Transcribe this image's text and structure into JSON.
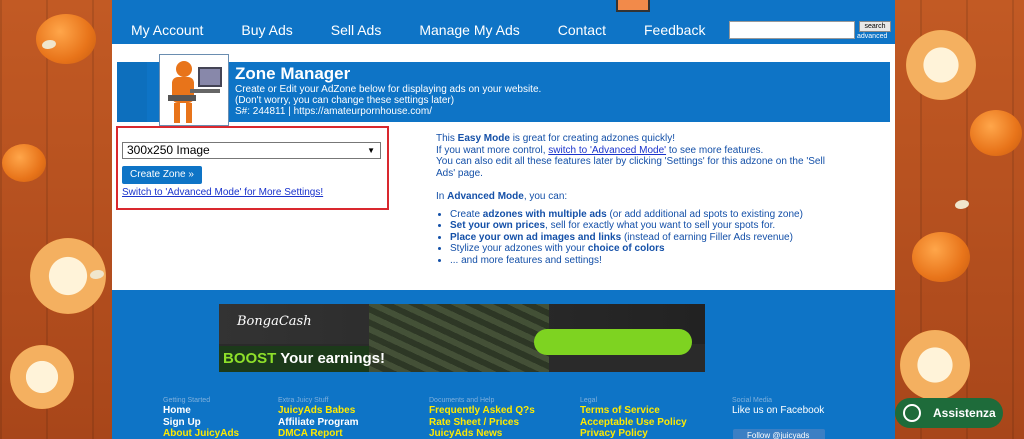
{
  "nav": {
    "items": [
      "My Account",
      "Buy Ads",
      "Sell Ads",
      "Manage My Ads",
      "Contact",
      "Feedback"
    ],
    "search_label": "search",
    "advanced_label": "advanced"
  },
  "zone_header": {
    "title": "Zone Manager",
    "line1": "Create or Edit your AdZone below for displaying ads on your website.",
    "line2": "(Don't worry, you can change these settings later)",
    "line3": "S#: 244811 | https://amateurpornhouse.com/"
  },
  "zone_form": {
    "select_value": "300x250 Image",
    "create_button": "Create Zone »",
    "advanced_link": "Switch to 'Advanced Mode' for More Settings!"
  },
  "info": {
    "p1_a": "This ",
    "p1_b": "Easy Mode",
    "p1_c": " is great for creating adzones quickly!",
    "p2_a": "If you want more control, ",
    "p2_link": "switch to 'Advanced Mode'",
    "p2_c": " to see more features.",
    "p3": "You can also edit all these features later by clicking 'Settings' for this adzone on the 'Sell Ads' page.",
    "p4_a": "In ",
    "p4_b": "Advanced Mode",
    "p4_c": ", you can:",
    "bullets": [
      {
        "b": "adzones with multiple ads",
        "pre": "Create ",
        "post": " (or add additional ad spots to existing zone)"
      },
      {
        "b": "Set your own prices",
        "pre": "",
        "post": ", sell for exactly what you want to sell your spots for."
      },
      {
        "b": "Place your own ad images and links",
        "pre": "",
        "post": " (instead of earning Filler Ads revenue)"
      },
      {
        "b": "choice of colors",
        "pre": "Stylize your adzones with your ",
        "post": ""
      },
      {
        "b": "",
        "pre": "... and more features and settings!",
        "post": ""
      }
    ]
  },
  "banner": {
    "logo": "BongaCash",
    "boost_a": "BOOST",
    "boost_b": " Your earnings!"
  },
  "footer": {
    "col1": {
      "heading": "Getting Started",
      "items": [
        "Home",
        "Sign Up",
        "About JuicyAds"
      ]
    },
    "col2": {
      "heading": "Extra Juicy Stuff",
      "items": [
        "JuicyAds Babes",
        "Affiliate Program",
        "DMCA Report"
      ]
    },
    "col3": {
      "heading": "Documents and Help",
      "items": [
        "Frequently Asked Q?s",
        "Rate Sheet / Prices",
        "JuicyAds News"
      ]
    },
    "col4": {
      "heading": "Legal",
      "items": [
        "Terms of Service",
        "Acceptable Use Policy",
        "Privacy Policy"
      ]
    },
    "col5": {
      "heading": "Social Media",
      "items": [
        "Like us on Facebook"
      ]
    },
    "follow": "Follow @juicyads"
  },
  "assist": {
    "label": "Assistenza"
  },
  "colors": {
    "primary_blue": "#0e74c6",
    "accent_red": "#d9282e",
    "footer_yellow": "#ffea00",
    "assist_green": "#1e6b3a"
  }
}
